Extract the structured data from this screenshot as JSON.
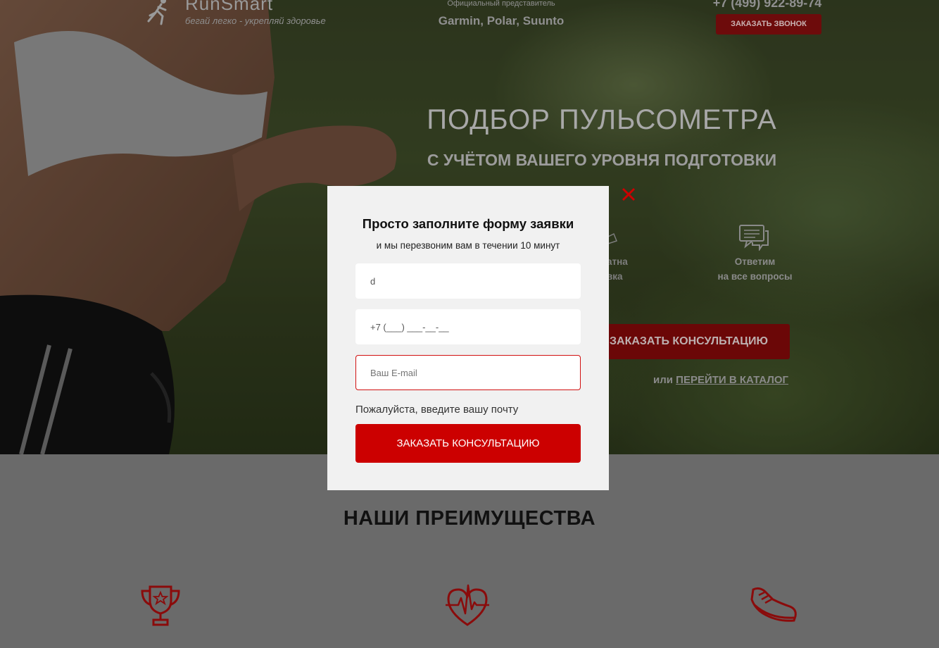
{
  "header": {
    "logo_text": "RunSmart",
    "logo_tagline": "бегай легко - укрепляй здоровье",
    "official_label": "Официальный представитель",
    "brands": "Garmin, Polar, Suunto",
    "phone": "+7 (499) 922-89-74",
    "call_button": "ЗАКАЗАТЬ ЗВОНОК"
  },
  "hero": {
    "title": "ПОДБОР ПУЛЬСОМЕТРА",
    "subtitle": "С УЧЁТОМ ВАШЕГО УРОВНЯ ПОДГОТОВКИ",
    "feature_partial_line1": "атна",
    "feature_partial_line2": "вка",
    "feature_answer_line1": "Ответим",
    "feature_answer_line2": "на все вопросы",
    "consult_button": "ЗАКАЗАТЬ КОНСУЛЬТАЦИЮ",
    "or_label": "или",
    "catalog_link": "ПЕРЕЙТИ В КАТАЛОГ"
  },
  "advantages": {
    "title": "НАШИ ПРЕИМУЩЕСТВА",
    "icons": [
      "trophy-icon",
      "heart-pulse-icon",
      "sneaker-icon"
    ]
  },
  "modal": {
    "title": "Просто заполните форму заявки",
    "subtitle": "и мы перезвоним вам в течении 10 минут",
    "name_value": "d",
    "phone_value": "+7 (___) ___-__-__",
    "email_placeholder": "Ваш E-mail",
    "email_error": "Пожалуйста, введите вашу почту",
    "submit_label": "ЗАКАЗАТЬ КОНСУЛЬТАЦИЮ"
  },
  "colors": {
    "accent": "#cc0000",
    "dark_accent": "#6d0b0b",
    "overlay_bg": "#6a6a6a"
  }
}
